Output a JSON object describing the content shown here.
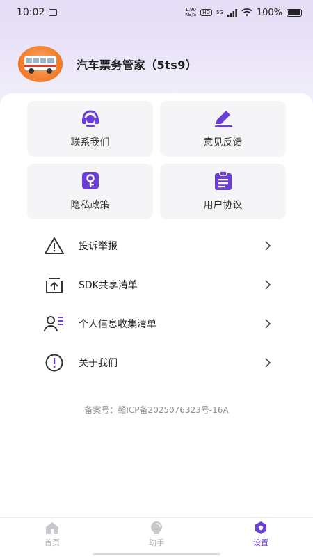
{
  "status_bar": {
    "time": "10:02",
    "net_speed_top": "1.90",
    "net_speed_bottom": "KB/S",
    "hd_label": "HD",
    "signal_label": "5G",
    "battery_text": "100%"
  },
  "profile": {
    "title": "汽车票务管家（5ts9）"
  },
  "cards": [
    {
      "label": "联系我们",
      "icon": "headset-icon"
    },
    {
      "label": "意见反馈",
      "icon": "pencil-icon"
    },
    {
      "label": "隐私政策",
      "icon": "key-icon"
    },
    {
      "label": "用户协议",
      "icon": "clipboard-icon"
    }
  ],
  "menu": [
    {
      "label": "投诉举报",
      "icon": "warning-icon"
    },
    {
      "label": "SDK共享清单",
      "icon": "share-box-icon"
    },
    {
      "label": "个人信息收集清单",
      "icon": "person-list-icon"
    },
    {
      "label": "关于我们",
      "icon": "info-circle-icon"
    }
  ],
  "footer": {
    "icp": "备案号：赣ICP备2025076323号-16A"
  },
  "tabbar": [
    {
      "label": "首页",
      "icon": "home-icon",
      "active": false
    },
    {
      "label": "助手",
      "icon": "assistant-icon",
      "active": false
    },
    {
      "label": "设置",
      "icon": "settings-icon",
      "active": true
    }
  ],
  "colors": {
    "accent": "#6b3fd6",
    "card_bg": "#f5f5f7",
    "header_gradient": "#e4ddf6"
  }
}
